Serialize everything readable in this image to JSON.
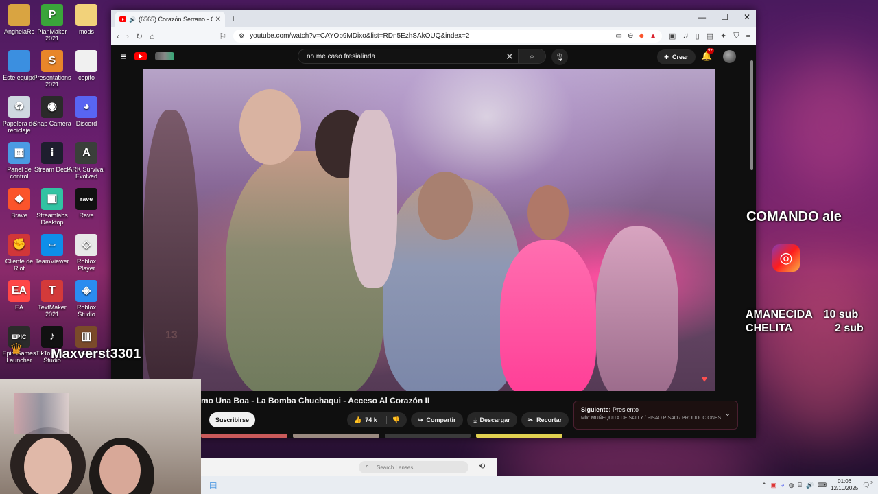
{
  "desktop": {
    "icons": [
      {
        "label": "AnghelaRc",
        "icon": "folder-user-icon",
        "color": "#d9a441",
        "glyph": ""
      },
      {
        "label": "PlanMaker 2021",
        "icon": "planmaker-icon",
        "color": "#3aa53a",
        "glyph": "P"
      },
      {
        "label": "mods",
        "icon": "folder-icon",
        "color": "#f2d27a",
        "glyph": ""
      },
      {
        "label": "Este equipo",
        "icon": "computer-icon",
        "color": "#3b8fe0",
        "glyph": ""
      },
      {
        "label": "Presentations 2021",
        "icon": "presentations-icon",
        "color": "#e8862a",
        "glyph": "S"
      },
      {
        "label": "copito",
        "icon": "file-icon",
        "color": "#f0f0f0",
        "glyph": ""
      },
      {
        "label": "Papelera de reciclaje",
        "icon": "recycle-bin-icon",
        "color": "#cfd8e0",
        "glyph": "♻"
      },
      {
        "label": "Snap Camera",
        "icon": "snap-camera-icon",
        "color": "#2a2a2a",
        "glyph": "◉"
      },
      {
        "label": "Discord",
        "icon": "discord-icon",
        "color": "#5865f2",
        "glyph": "◕"
      },
      {
        "label": "Panel de control",
        "icon": "control-panel-icon",
        "color": "#4b9be3",
        "glyph": "▦"
      },
      {
        "label": "Stream Deck",
        "icon": "stream-deck-icon",
        "color": "#1e1e2e",
        "glyph": "⁞"
      },
      {
        "label": "ARK Survival Evolved",
        "icon": "ark-icon",
        "color": "#3a3f3a",
        "glyph": "A"
      },
      {
        "label": "Brave",
        "icon": "brave-icon",
        "color": "#fb542b",
        "glyph": "◆"
      },
      {
        "label": "Streamlabs Desktop",
        "icon": "streamlabs-icon",
        "color": "#31c3a2",
        "glyph": "▣"
      },
      {
        "label": "Rave",
        "icon": "rave-icon",
        "color": "#111111",
        "glyph": "rave"
      },
      {
        "label": "Cliente de Riot",
        "icon": "riot-icon",
        "color": "#d13639",
        "glyph": "✊"
      },
      {
        "label": "TeamViewer",
        "icon": "teamviewer-icon",
        "color": "#0e8ee9",
        "glyph": "⇔"
      },
      {
        "label": "Roblox Player",
        "icon": "roblox-player-icon",
        "color": "#e8e8e8",
        "glyph": "◇"
      },
      {
        "label": "EA",
        "icon": "ea-icon",
        "color": "#ff4747",
        "glyph": "EA"
      },
      {
        "label": "TextMaker 2021",
        "icon": "textmaker-icon",
        "color": "#d33a3a",
        "glyph": "T"
      },
      {
        "label": "Roblox Studio",
        "icon": "roblox-studio-icon",
        "color": "#2a8cf0",
        "glyph": "◈"
      },
      {
        "label": "Epic Games Launcher",
        "icon": "epic-games-icon",
        "color": "#2b2b2b",
        "glyph": "EPIC"
      },
      {
        "label": "TikTok LIVE Studio",
        "icon": "tiktok-icon",
        "color": "#111111",
        "glyph": "♪"
      },
      {
        "label": "Tavern",
        "icon": "tavern-icon",
        "color": "#7a4a2a",
        "glyph": "▥"
      }
    ]
  },
  "browser": {
    "tab_title": "(6565) Corazón Serrano - Có",
    "url": "youtube.com/watch?v=CAYOb9MDixo&list=RDn5EzhSAkOUQ&index=2"
  },
  "youtube": {
    "search_value": "no me caso fresialinda",
    "create_label": "Crear",
    "notif_badge": "9+",
    "video_title": "mo Una Boa - La Bomba Chuchaqui - Acceso Al Corazón II",
    "subscribe_label": "Suscribirse",
    "likes": "74 k",
    "share_label": "Compartir",
    "download_label": "Descargar",
    "clip_label": "Recortar",
    "next_label": "Siguiente:",
    "next_title": "Presiento",
    "next_sub": "Mix: MUÑEQUITA DE SALLY / PISAO PISAO / PRODUCCIONES",
    "video_overlay_number": "13"
  },
  "overlay": {
    "username": "Maxverst3301",
    "comando": "COMANDO ale",
    "sub1_name": "AMANECIDA",
    "sub1_count": "10 sub",
    "sub2_name": "CHELITA",
    "sub2_count": "2 sub"
  },
  "lens": {
    "search_placeholder": "Search Lenses"
  },
  "taskbar": {
    "time": "01:06",
    "date": "12/10/2025",
    "notif_count": "2"
  }
}
